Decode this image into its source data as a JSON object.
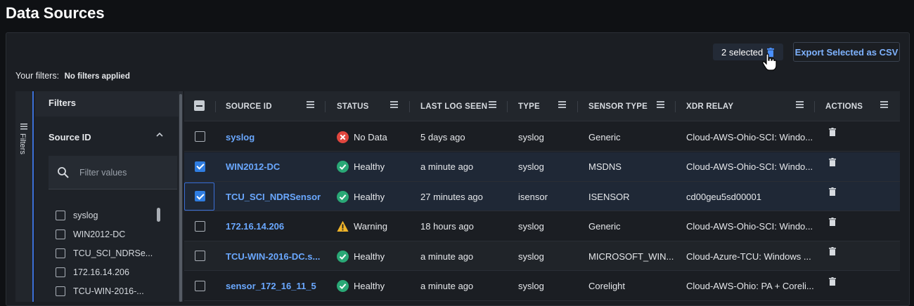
{
  "page": {
    "title": "Data Sources"
  },
  "toolbar": {
    "selected_label": "2 selected",
    "export_label": "Export Selected as CSV"
  },
  "filters_summary": {
    "label": "Your filters:",
    "value": "No filters applied"
  },
  "filter_panel": {
    "rail_label": "Filters",
    "header": "Filters",
    "group_title": "Source ID",
    "search_placeholder": "Filter values",
    "options": [
      "syslog",
      "WIN2012-DC",
      "TCU_SCI_NDRSe...",
      "172.16.14.206",
      "TCU-WIN-2016-..."
    ]
  },
  "table": {
    "columns": [
      "SOURCE ID",
      "STATUS",
      "LAST LOG SEEN",
      "TYPE",
      "SENSOR TYPE",
      "XDR RELAY",
      "ACTIONS"
    ],
    "rows": [
      {
        "checked": false,
        "source_id": "syslog",
        "status": "No Data",
        "status_kind": "error",
        "last_log": "5 days ago",
        "type": "syslog",
        "sensor_type": "Generic",
        "relay": "Cloud-AWS-Ohio-SCI: Windo..."
      },
      {
        "checked": true,
        "source_id": "WIN2012-DC",
        "status": "Healthy",
        "status_kind": "ok",
        "last_log": "a minute ago",
        "type": "syslog",
        "sensor_type": "MSDNS",
        "relay": "Cloud-AWS-Ohio-SCI: Windo..."
      },
      {
        "checked": true,
        "source_id": "TCU_SCI_NDRSensor",
        "status": "Healthy",
        "status_kind": "ok",
        "last_log": "27 minutes ago",
        "type": "isensor",
        "sensor_type": "ISENSOR",
        "relay": "cd00geu5sd00001"
      },
      {
        "checked": false,
        "source_id": "172.16.14.206",
        "status": "Warning",
        "status_kind": "warn",
        "last_log": "18 hours ago",
        "type": "syslog",
        "sensor_type": "Generic",
        "relay": "Cloud-AWS-Ohio-SCI: Windo..."
      },
      {
        "checked": false,
        "source_id": "TCU-WIN-2016-DC.s...",
        "status": "Healthy",
        "status_kind": "ok",
        "last_log": "a minute ago",
        "type": "syslog",
        "sensor_type": "MICROSOFT_WIN...",
        "relay": "Cloud-Azure-TCU: Windows ..."
      },
      {
        "checked": false,
        "source_id": "sensor_172_16_11_5",
        "status": "Healthy",
        "status_kind": "ok",
        "last_log": "a minute ago",
        "type": "syslog",
        "sensor_type": "Corelight",
        "relay": "Cloud-AWS-Ohio: PA + Coreli..."
      }
    ]
  },
  "colors": {
    "accent": "#3b6fd6",
    "link": "#6aa8ff",
    "ok": "#2aa876",
    "error": "#e0463e",
    "warn": "#f0b429"
  }
}
